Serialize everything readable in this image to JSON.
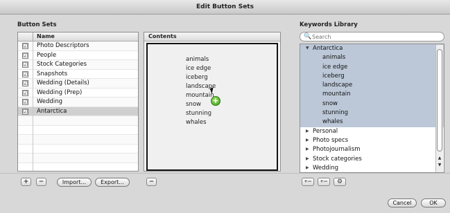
{
  "window": {
    "title": "Edit Button Sets"
  },
  "button_sets": {
    "section_title": "Button Sets",
    "column_name": "Name",
    "rows": [
      {
        "label": "Photo Descriptors",
        "checked": true
      },
      {
        "label": "People",
        "checked": true
      },
      {
        "label": "Stock Categories",
        "checked": true
      },
      {
        "label": "Snapshots",
        "checked": true
      },
      {
        "label": "Wedding (Details)",
        "checked": true
      },
      {
        "label": "Wedding (Prep)",
        "checked": true
      },
      {
        "label": "Wedding",
        "checked": true
      },
      {
        "label": "Antarctica",
        "checked": true
      }
    ],
    "check_glyph": "☑",
    "add_label": "+",
    "remove_label": "−",
    "import_label": "Import...",
    "export_label": "Export..."
  },
  "contents": {
    "column_name": "Contents",
    "keywords": [
      "animals",
      "ice edge",
      "iceberg",
      "landscape",
      "mountain",
      "snow",
      "stunning",
      "whales"
    ],
    "remove_label": "−",
    "drop_add_glyph": "+"
  },
  "keywords_library": {
    "section_title": "Keywords Library",
    "search_placeholder": "Search",
    "search_icon": "🔍",
    "expanded_group": "Antarctica",
    "expanded_items": [
      "animals",
      "ice edge",
      "iceberg",
      "landscape",
      "mountain",
      "snow",
      "stunning",
      "whales"
    ],
    "collapsed_groups": [
      "Personal",
      "Photo specs",
      "Photojournalism",
      "Stock categories",
      "Wedding"
    ],
    "expanded_triangle": "▼",
    "collapsed_triangle": "▶",
    "scroll_up": "▲",
    "scroll_down": "▼",
    "tool_add_sibling": "+—",
    "tool_add_child": "+—",
    "tool_action": "⚙"
  },
  "footer": {
    "cancel_label": "Cancel",
    "ok_label": "OK"
  }
}
